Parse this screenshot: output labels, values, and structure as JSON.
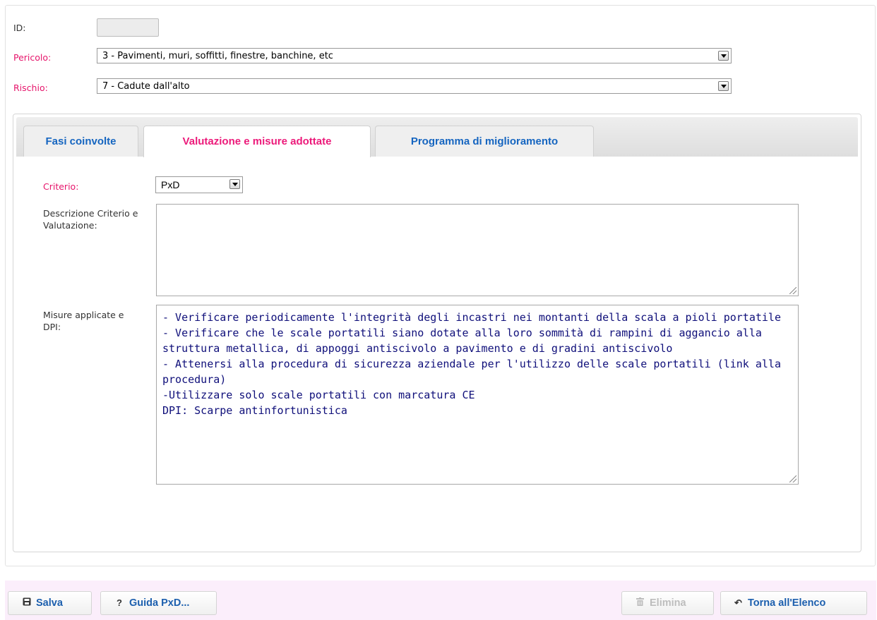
{
  "form": {
    "id_label": "ID:",
    "id_value": "",
    "pericolo_label": "Pericolo:",
    "pericolo_value": "3 - Pavimenti, muri, soffitti, finestre, banchine, etc",
    "rischio_label": "Rischio:",
    "rischio_value": "7 - Cadute dall'alto"
  },
  "tabs": [
    {
      "label": "Fasi coinvolte",
      "active": false
    },
    {
      "label": "Valutazione e misure adottate",
      "active": true
    },
    {
      "label": "Programma di miglioramento",
      "active": false
    }
  ],
  "valutazione": {
    "criterio_label": "Criterio:",
    "criterio_value": "PxD",
    "descrizione_label": "Descrizione Criterio e Valutazione:",
    "descrizione_value": "",
    "misure_label": "Misure applicate e DPI:",
    "misure_value": "- Verificare periodicamente l'integrità degli incastri nei montanti della scala a pioli portatile\n- Verificare che le scale portatili siano dotate alla loro sommità di rampini di aggancio alla struttura metallica, di appoggi antiscivolo a pavimento e di gradini antiscivolo\n- Attenersi alla procedura di sicurezza aziendale per l'utilizzo delle scale portatili (link alla procedura)\n-Utilizzare solo scale portatili con marcatura CE\nDPI: Scarpe antinfortunistica"
  },
  "toolbar": {
    "save_label": "Salva",
    "save_icon": "save-icon",
    "guide_label": "Guida PxD...",
    "guide_icon": "?",
    "delete_label": "Elimina",
    "delete_icon": "trash-icon",
    "back_label": "Torna all'Elenco",
    "back_icon": "↶"
  },
  "colors": {
    "required_label": "#e6156b",
    "tab_link": "#1565c0",
    "tab_active": "#ec1a7a",
    "button_text": "#1c5fae",
    "toolbar_bg": "#fbeefb",
    "textarea_text": "#0f0f7a"
  }
}
